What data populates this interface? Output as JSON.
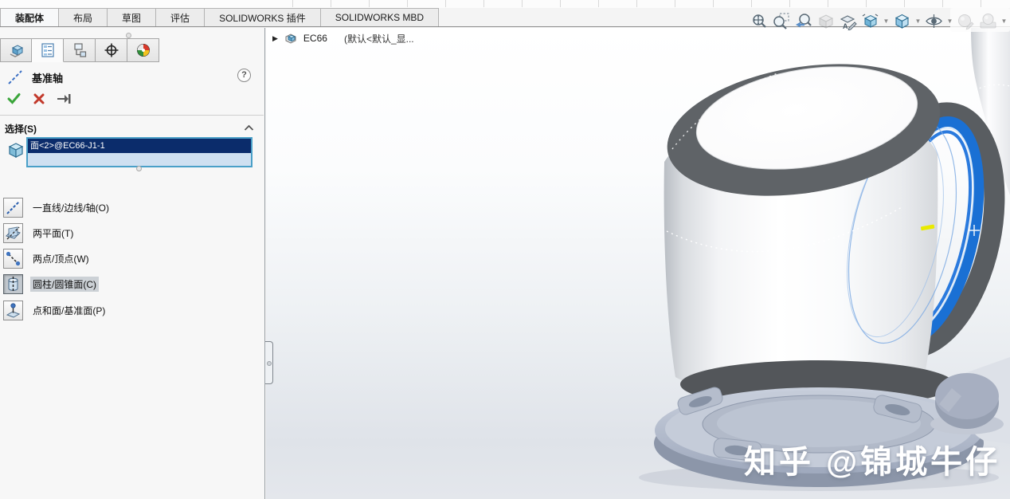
{
  "app": {
    "name": "SOLIDWORKS"
  },
  "command_tabs": {
    "items": [
      "装配体",
      "布局",
      "草图",
      "评估",
      "SOLIDWORKS 插件",
      "SOLIDWORKS MBD"
    ],
    "active": "装配体"
  },
  "panel_tabs": {
    "icons": [
      "feature-manager-tree-icon",
      "property-manager-icon",
      "configuration-manager-icon",
      "dimxpert-manager-icon",
      "display-manager-icon"
    ],
    "active": "property-manager-icon"
  },
  "property_manager": {
    "title": "基准轴",
    "help_label": "?",
    "actions": {
      "ok": "ok-check-icon",
      "cancel": "cancel-x-icon",
      "pin": "pin-icon"
    },
    "selection": {
      "header": "选择(S)",
      "filter_icon": "face-selection-icon",
      "items": [
        "面<2>@EC66-J1-1"
      ]
    },
    "options": [
      {
        "label": "一直线/边线/轴(O)",
        "icon": "line-edge-axis-icon",
        "selected": false
      },
      {
        "label": "两平面(T)",
        "icon": "two-planes-icon",
        "selected": false
      },
      {
        "label": "两点/顶点(W)",
        "icon": "two-points-vertices-icon",
        "selected": false
      },
      {
        "label": "圆柱/圆锥面(C)",
        "icon": "cylindrical-conical-face-icon",
        "selected": true
      },
      {
        "label": "点和面/基准面(P)",
        "icon": "point-and-surface-icon",
        "selected": false
      }
    ]
  },
  "viewport": {
    "breadcrumb": {
      "expand_arrow": "▶",
      "component_icon": "assembly-component-icon",
      "component": "EC66",
      "config": "(默认<默认_显..."
    },
    "watermark": "知乎 @锦城牛仔",
    "heads_up_toolbar": [
      "zoom-to-fit-icon",
      "zoom-to-area-icon",
      "previous-view-icon",
      "section-view-icon",
      "annotation-views-icon",
      "view-orientation-icon",
      "display-style-icon",
      "hide-show-items-icon",
      "edit-appearance-icon",
      "apply-scene-icon",
      "view-settings-icon"
    ],
    "selected_face_highlight": "temporary-axis-yellow-marker"
  },
  "colors": {
    "selection_row": "#0b2c6b",
    "selection_box_fill": "#cfe0f1",
    "selection_box_border": "#4aa0c8",
    "selected_face_blue": "#1a70d4",
    "axis_marker_yellow": "#e9ea00",
    "watermark": "#ffffff",
    "dark_rim_gray": "#5f6367",
    "base_metal": "#a6afc2"
  }
}
